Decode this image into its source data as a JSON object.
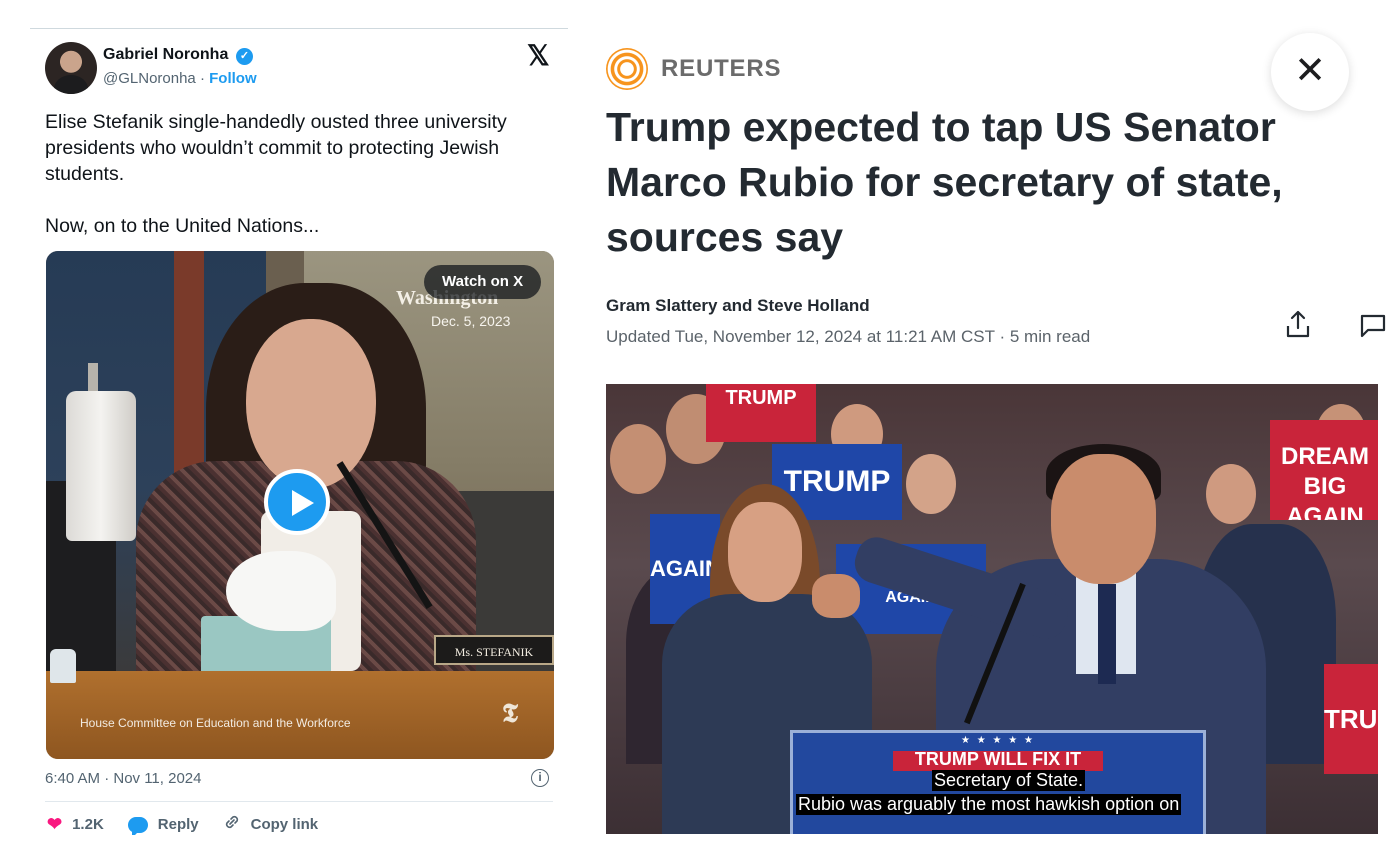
{
  "tweet": {
    "author_name": "Gabriel Noronha",
    "verified_mark": "✓",
    "handle": "@GLNoronha",
    "separator": "·",
    "follow_label": "Follow",
    "x_logo": "𝕏",
    "paragraphs": [
      "Elise Stefanik single-handedly ousted three university presidents who wouldn’t commit to protecting Jewish students.",
      "Now, on to the United Nations..."
    ],
    "video": {
      "watch_label": "Watch on X",
      "location_overlay": "Washington",
      "date_overlay": "Dec. 5, 2023",
      "nameplate": "Ms. STEFANIK",
      "lower_caption": "House Committee on Education and the Workforce",
      "watermark": "𝕿"
    },
    "timestamp": "6:40 AM · Nov 11, 2024",
    "info_glyph": "i",
    "actions": {
      "likes_count": "1.2K",
      "reply_label": "Reply",
      "copy_label": "Copy link"
    },
    "icons": [
      "x-logo",
      "verified-badge",
      "play",
      "info",
      "heart",
      "reply-bubble",
      "link"
    ],
    "colors": {
      "accent": "#1d9bf0",
      "heart": "#f91880"
    }
  },
  "article": {
    "source_name": "REUTERS",
    "close_glyph": "✕",
    "headline": "Trump expected to tap US Senator Marco Rubio for secretary of state, sources say",
    "byline": "Gram Slattery and Steve Holland",
    "updated": "Updated Tue, November 12, 2024 at 11:21 AM CST",
    "dot": "·",
    "read_time": "5 min read",
    "icons": [
      "reuters-logo",
      "close",
      "share",
      "comment"
    ],
    "photo": {
      "signs": [
        "TRUMP",
        "WILL FIX IT",
        "DREAM BIG",
        "AGAIN"
      ],
      "podium_stars": "★ ★ ★ ★ ★",
      "podium_text": "TRUMP WILL FIX IT",
      "subtitle_line1": "Secretary of State.",
      "subtitle_line2": "Rubio was arguably the most hawkish option on"
    },
    "colors": {
      "brand": "#f7941d",
      "headline": "#232a31"
    }
  }
}
